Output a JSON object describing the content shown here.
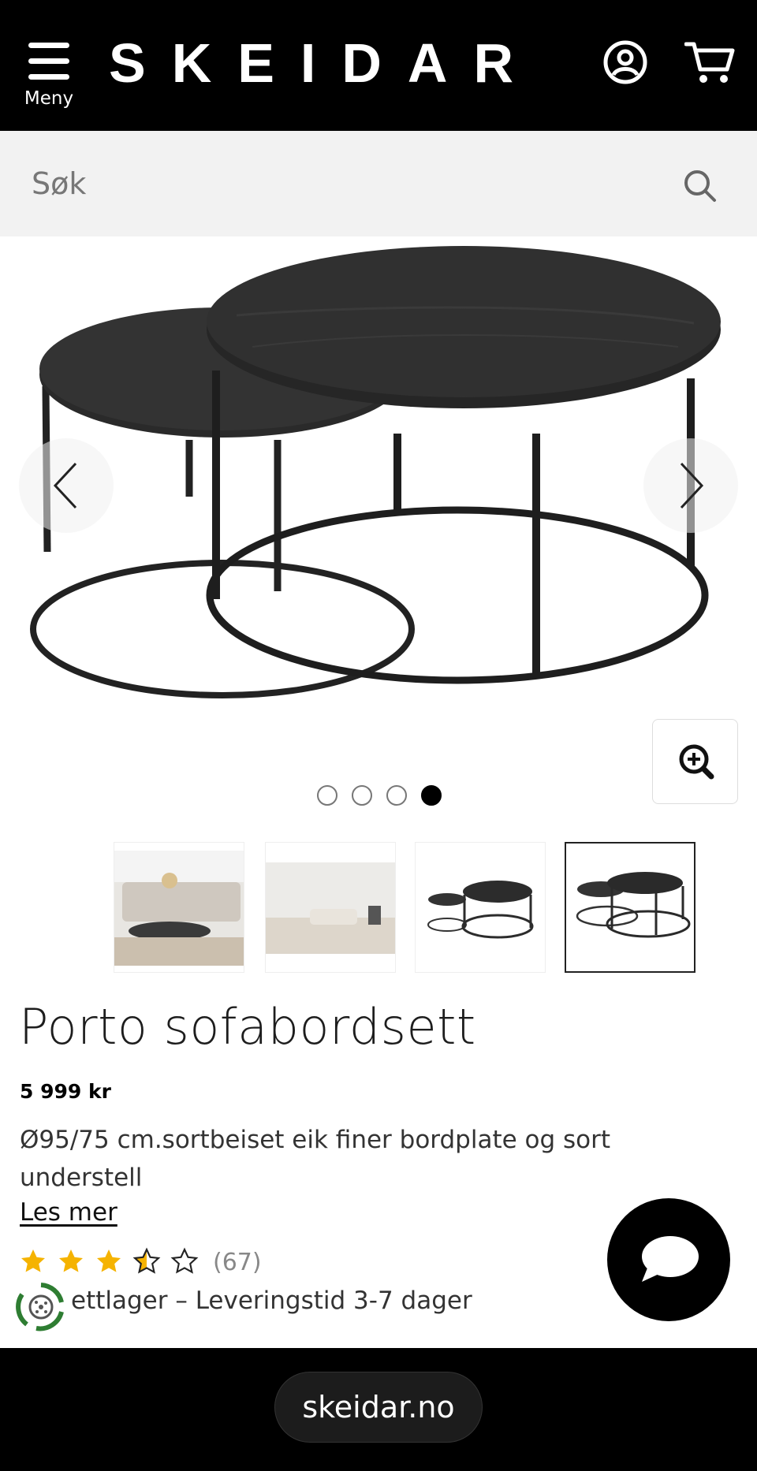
{
  "header": {
    "menu_label": "Meny",
    "brand": "SKEIDAR"
  },
  "search": {
    "placeholder": "Søk"
  },
  "gallery": {
    "dots_total": 4,
    "active_dot": 4,
    "thumbnails_count": 4,
    "selected_thumbnail": 4
  },
  "product": {
    "title": "Porto sofabordsett",
    "price": "5 999 kr",
    "description": "Ø95/75 cm.sortbeiset eik finer bordplate og sort understell",
    "read_more": "Les mer",
    "rating_value": 3.5,
    "rating_max": 5,
    "review_count": "(67)",
    "stock_text": "ettlager – Leveringstid 3-7 dager"
  },
  "browser": {
    "url": "skeidar.no"
  },
  "colors": {
    "header_bg": "#000000",
    "star_filled": "#f5b301",
    "eco_green": "#2e7d32"
  }
}
